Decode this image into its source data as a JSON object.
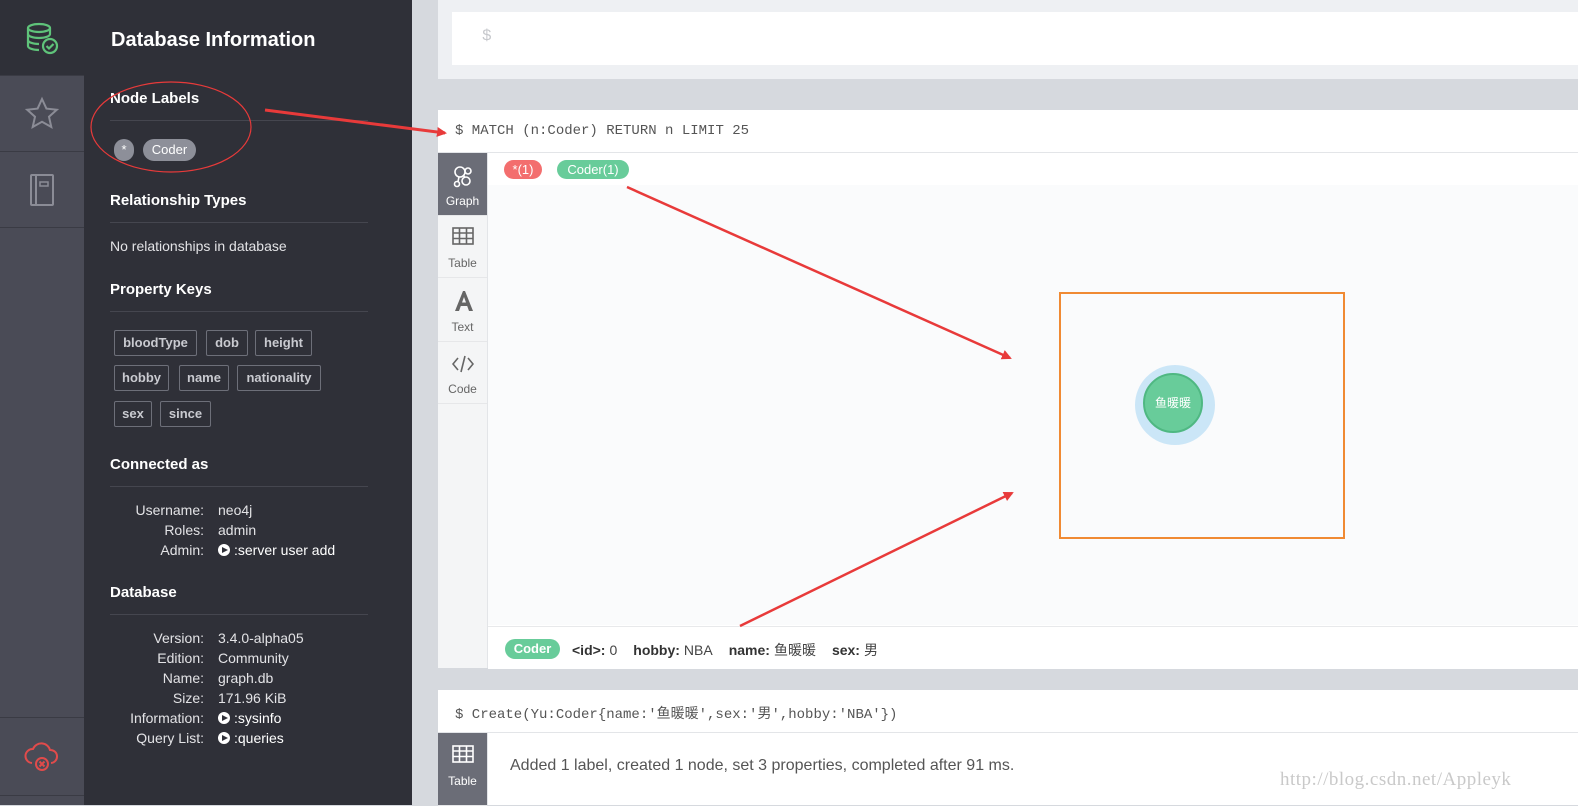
{
  "sidebar": {
    "title": "Database Information",
    "node_labels": {
      "heading": "Node Labels",
      "items": [
        "*",
        "Coder"
      ]
    },
    "relationship_types": {
      "heading": "Relationship Types",
      "empty_text": "No relationships in database"
    },
    "property_keys": {
      "heading": "Property Keys",
      "items": [
        "bloodType",
        "dob",
        "height",
        "hobby",
        "name",
        "nationality",
        "sex",
        "since"
      ]
    },
    "connected_as": {
      "heading": "Connected as",
      "rows": [
        {
          "key": "Username:",
          "value": "neo4j"
        },
        {
          "key": "Roles:",
          "value": "admin"
        },
        {
          "key": "Admin:",
          "value": ":server user add"
        }
      ]
    },
    "database": {
      "heading": "Database",
      "rows": [
        {
          "key": "Version:",
          "value": "3.4.0-alpha05"
        },
        {
          "key": "Edition:",
          "value": "Community"
        },
        {
          "key": "Name:",
          "value": "graph.db"
        },
        {
          "key": "Size:",
          "value": "171.96 KiB"
        },
        {
          "key": "Information:",
          "value": ":sysinfo"
        },
        {
          "key": "Query List:",
          "value": ":queries"
        }
      ]
    }
  },
  "rail_icons": [
    "database-icon",
    "star-icon",
    "document-icon",
    "cloud-disconnected-icon"
  ],
  "editor": {
    "prompt": "$"
  },
  "frame1": {
    "command": "$ MATCH (n:Coder) RETURN n LIMIT 25",
    "tabs": [
      "Graph",
      "Table",
      "Text",
      "Code"
    ],
    "label_pills": [
      "*(1)",
      "Coder(1)"
    ],
    "node": {
      "caption": "鱼暖暖"
    },
    "properties": {
      "label": "Coder",
      "items": [
        {
          "key": "<id>:",
          "value": "0"
        },
        {
          "key": "hobby:",
          "value": "NBA"
        },
        {
          "key": "name:",
          "value": "鱼暖暖"
        },
        {
          "key": "sex:",
          "value": "男"
        }
      ]
    }
  },
  "frame2": {
    "command": "$ Create(Yu:Coder{name:'鱼暖暖',sex:'男',hobby:'NBA'})",
    "tab": "Table",
    "result": "Added 1 label, created 1 node, set 3 properties, completed after 91 ms."
  },
  "watermark": "http://blog.csdn.net/Appleyk",
  "colors": {
    "green": "#68cc9a",
    "red_pill": "#f36e6e",
    "highlight_box": "#f08a33",
    "arrow": "#e83a3a"
  }
}
